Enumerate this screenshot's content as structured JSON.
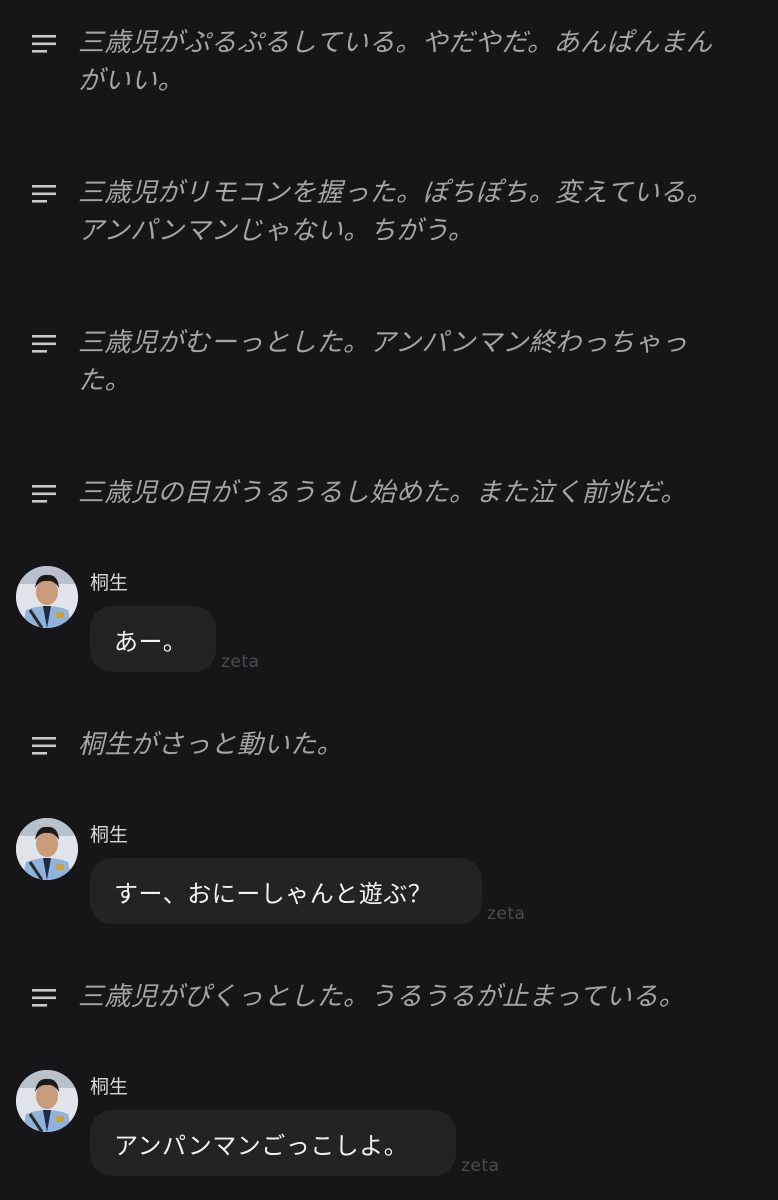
{
  "icons": {
    "narration": "lines-icon",
    "avatar": "avatar-officer"
  },
  "colors": {
    "background": "#161618",
    "bubble": "#232326",
    "narration_text": "#a5a5a8",
    "watermark": "#4c4c50"
  },
  "feed": {
    "narration_1": "三歳児がぷるぷるしている。やだやだ。あんぱんまんがいい。",
    "narration_2": "三歳児がリモコンを握った。ぽちぽち。変えている。アンパンマンじゃない。ちがう。",
    "narration_3": "三歳児がむーっとした。アンパンマン終わっちゃった。",
    "narration_4": "三歳児の目がうるうるし始めた。また泣く前兆だ。",
    "message_1": {
      "sender": "桐生",
      "text": "あー。",
      "watermark": "zeta"
    },
    "narration_5": "桐生がさっと動いた。",
    "message_2": {
      "sender": "桐生",
      "text": "すー、おにーしゃんと遊ぶ？",
      "watermark": "zeta"
    },
    "narration_6": "三歳児がぴくっとした。うるうるが止まっている。",
    "message_3": {
      "sender": "桐生",
      "text": "アンパンマンごっこしよ。",
      "watermark": "zeta"
    }
  }
}
